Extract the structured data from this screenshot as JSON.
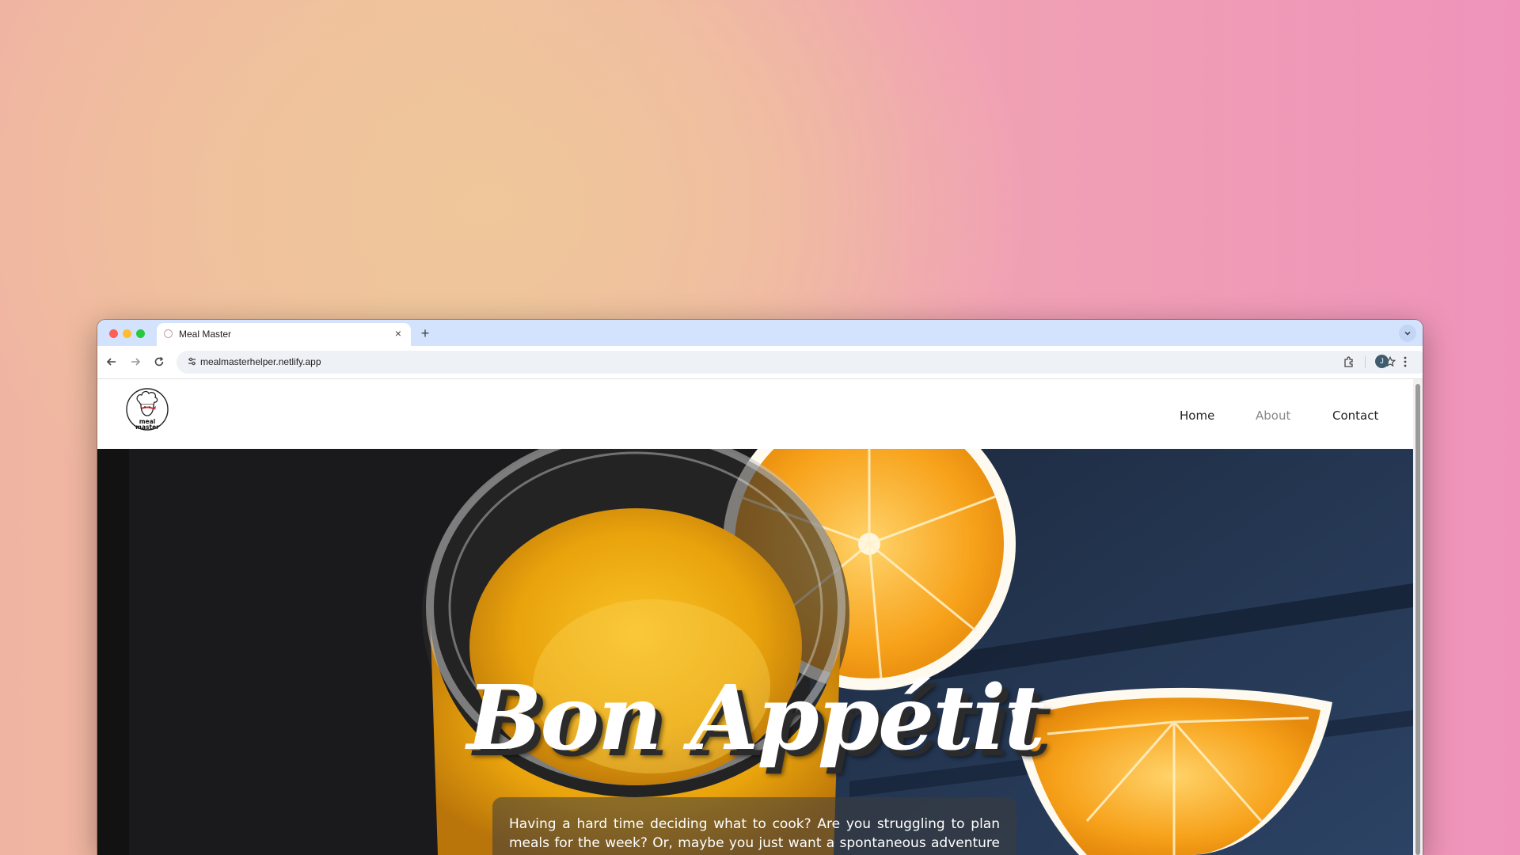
{
  "browser": {
    "tab_title": "Meal Master",
    "new_tab_symbol": "+",
    "close_symbol": "×",
    "url": "mealmasterhelper.netlify.app",
    "profile_initial": "J"
  },
  "site": {
    "logo_text_line1": "meal",
    "logo_text_line2": "master",
    "nav": {
      "home": "Home",
      "about": "About",
      "contact": "Contact"
    },
    "hero": {
      "title": "Bon Appétit",
      "description": "Having a hard time deciding what to cook? Are you struggling to plan meals for the week? Or, maybe you just want a spontaneous adventure for"
    }
  },
  "colors": {
    "tabstrip": "#d3e3fd",
    "accent_orange": "#f7a21b"
  },
  "icons": [
    "back-arrow-icon",
    "forward-arrow-icon",
    "reload-icon",
    "site-info-icon",
    "star-icon",
    "extensions-icon",
    "menu-icon",
    "chef-logo-icon",
    "tab-search-icon"
  ]
}
